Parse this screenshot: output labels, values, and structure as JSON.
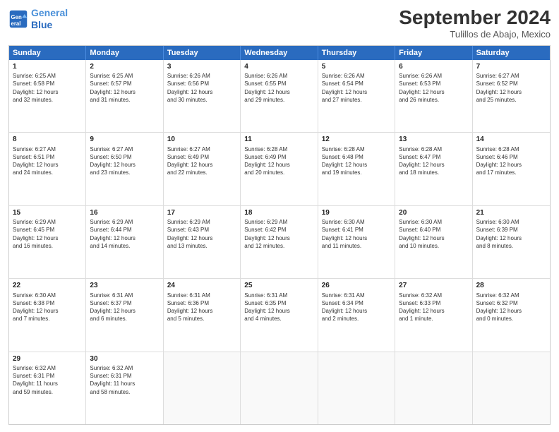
{
  "logo": {
    "line1": "General",
    "line2": "Blue"
  },
  "title": "September 2024",
  "location": "Tulillos de Abajo, Mexico",
  "days_header": [
    "Sunday",
    "Monday",
    "Tuesday",
    "Wednesday",
    "Thursday",
    "Friday",
    "Saturday"
  ],
  "weeks": [
    [
      {
        "day": "1",
        "info": "Sunrise: 6:25 AM\nSunset: 6:58 PM\nDaylight: 12 hours\nand 32 minutes."
      },
      {
        "day": "2",
        "info": "Sunrise: 6:25 AM\nSunset: 6:57 PM\nDaylight: 12 hours\nand 31 minutes."
      },
      {
        "day": "3",
        "info": "Sunrise: 6:26 AM\nSunset: 6:56 PM\nDaylight: 12 hours\nand 30 minutes."
      },
      {
        "day": "4",
        "info": "Sunrise: 6:26 AM\nSunset: 6:55 PM\nDaylight: 12 hours\nand 29 minutes."
      },
      {
        "day": "5",
        "info": "Sunrise: 6:26 AM\nSunset: 6:54 PM\nDaylight: 12 hours\nand 27 minutes."
      },
      {
        "day": "6",
        "info": "Sunrise: 6:26 AM\nSunset: 6:53 PM\nDaylight: 12 hours\nand 26 minutes."
      },
      {
        "day": "7",
        "info": "Sunrise: 6:27 AM\nSunset: 6:52 PM\nDaylight: 12 hours\nand 25 minutes."
      }
    ],
    [
      {
        "day": "8",
        "info": "Sunrise: 6:27 AM\nSunset: 6:51 PM\nDaylight: 12 hours\nand 24 minutes."
      },
      {
        "day": "9",
        "info": "Sunrise: 6:27 AM\nSunset: 6:50 PM\nDaylight: 12 hours\nand 23 minutes."
      },
      {
        "day": "10",
        "info": "Sunrise: 6:27 AM\nSunset: 6:49 PM\nDaylight: 12 hours\nand 22 minutes."
      },
      {
        "day": "11",
        "info": "Sunrise: 6:28 AM\nSunset: 6:49 PM\nDaylight: 12 hours\nand 20 minutes."
      },
      {
        "day": "12",
        "info": "Sunrise: 6:28 AM\nSunset: 6:48 PM\nDaylight: 12 hours\nand 19 minutes."
      },
      {
        "day": "13",
        "info": "Sunrise: 6:28 AM\nSunset: 6:47 PM\nDaylight: 12 hours\nand 18 minutes."
      },
      {
        "day": "14",
        "info": "Sunrise: 6:28 AM\nSunset: 6:46 PM\nDaylight: 12 hours\nand 17 minutes."
      }
    ],
    [
      {
        "day": "15",
        "info": "Sunrise: 6:29 AM\nSunset: 6:45 PM\nDaylight: 12 hours\nand 16 minutes."
      },
      {
        "day": "16",
        "info": "Sunrise: 6:29 AM\nSunset: 6:44 PM\nDaylight: 12 hours\nand 14 minutes."
      },
      {
        "day": "17",
        "info": "Sunrise: 6:29 AM\nSunset: 6:43 PM\nDaylight: 12 hours\nand 13 minutes."
      },
      {
        "day": "18",
        "info": "Sunrise: 6:29 AM\nSunset: 6:42 PM\nDaylight: 12 hours\nand 12 minutes."
      },
      {
        "day": "19",
        "info": "Sunrise: 6:30 AM\nSunset: 6:41 PM\nDaylight: 12 hours\nand 11 minutes."
      },
      {
        "day": "20",
        "info": "Sunrise: 6:30 AM\nSunset: 6:40 PM\nDaylight: 12 hours\nand 10 minutes."
      },
      {
        "day": "21",
        "info": "Sunrise: 6:30 AM\nSunset: 6:39 PM\nDaylight: 12 hours\nand 8 minutes."
      }
    ],
    [
      {
        "day": "22",
        "info": "Sunrise: 6:30 AM\nSunset: 6:38 PM\nDaylight: 12 hours\nand 7 minutes."
      },
      {
        "day": "23",
        "info": "Sunrise: 6:31 AM\nSunset: 6:37 PM\nDaylight: 12 hours\nand 6 minutes."
      },
      {
        "day": "24",
        "info": "Sunrise: 6:31 AM\nSunset: 6:36 PM\nDaylight: 12 hours\nand 5 minutes."
      },
      {
        "day": "25",
        "info": "Sunrise: 6:31 AM\nSunset: 6:35 PM\nDaylight: 12 hours\nand 4 minutes."
      },
      {
        "day": "26",
        "info": "Sunrise: 6:31 AM\nSunset: 6:34 PM\nDaylight: 12 hours\nand 2 minutes."
      },
      {
        "day": "27",
        "info": "Sunrise: 6:32 AM\nSunset: 6:33 PM\nDaylight: 12 hours\nand 1 minute."
      },
      {
        "day": "28",
        "info": "Sunrise: 6:32 AM\nSunset: 6:32 PM\nDaylight: 12 hours\nand 0 minutes."
      }
    ],
    [
      {
        "day": "29",
        "info": "Sunrise: 6:32 AM\nSunset: 6:31 PM\nDaylight: 11 hours\nand 59 minutes."
      },
      {
        "day": "30",
        "info": "Sunrise: 6:32 AM\nSunset: 6:31 PM\nDaylight: 11 hours\nand 58 minutes."
      },
      {
        "day": "",
        "info": ""
      },
      {
        "day": "",
        "info": ""
      },
      {
        "day": "",
        "info": ""
      },
      {
        "day": "",
        "info": ""
      },
      {
        "day": "",
        "info": ""
      }
    ]
  ]
}
